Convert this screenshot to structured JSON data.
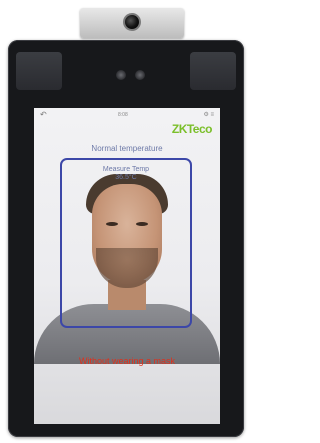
{
  "statusbar": {
    "back_icon": "back-arrow-icon",
    "clock": "8:08",
    "icons": "⚙ ≡"
  },
  "brand": {
    "logo_text": "ZKTeco",
    "color": "#7bbf2a"
  },
  "detection": {
    "temperature_status": "Normal temperature",
    "measure_label": "Measure Temp",
    "measure_value": "36.5°C",
    "warning": "Without wearing a mask",
    "box_color": "#3c47a8",
    "warning_color": "#e0301c"
  }
}
